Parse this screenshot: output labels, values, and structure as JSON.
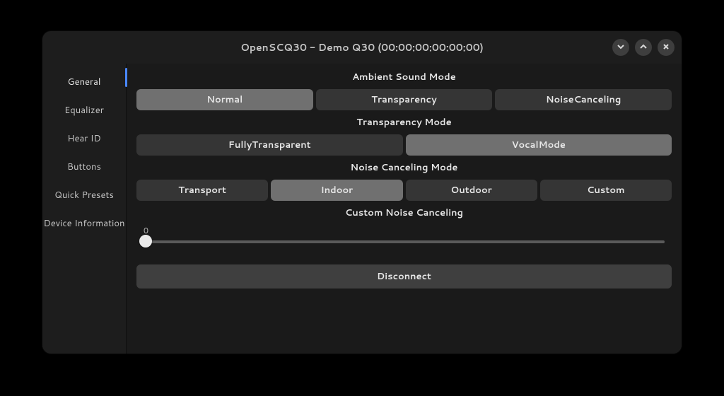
{
  "window": {
    "title": "OpenSCQ30 - Demo Q30 (00:00:00:00:00:00)"
  },
  "sidebar": {
    "items": [
      {
        "label": "General",
        "selected": true
      },
      {
        "label": "Equalizer",
        "selected": false
      },
      {
        "label": "Hear ID",
        "selected": false
      },
      {
        "label": "Buttons",
        "selected": false
      },
      {
        "label": "Quick Presets",
        "selected": false
      },
      {
        "label": "Device Information",
        "selected": false
      }
    ]
  },
  "sections": {
    "ambient_label": "Ambient Sound Mode",
    "ambient": [
      {
        "label": "Normal",
        "selected": true
      },
      {
        "label": "Transparency",
        "selected": false
      },
      {
        "label": "NoiseCanceling",
        "selected": false
      }
    ],
    "transparency_label": "Transparency Mode",
    "transparency": [
      {
        "label": "FullyTransparent",
        "selected": false
      },
      {
        "label": "VocalMode",
        "selected": true
      }
    ],
    "nc_label": "Noise Canceling Mode",
    "nc": [
      {
        "label": "Transport",
        "selected": false
      },
      {
        "label": "Indoor",
        "selected": true
      },
      {
        "label": "Outdoor",
        "selected": false
      },
      {
        "label": "Custom",
        "selected": false
      }
    ],
    "custom_nc_label": "Custom Noise Canceling",
    "custom_nc_value": "0"
  },
  "actions": {
    "disconnect_label": "Disconnect"
  }
}
